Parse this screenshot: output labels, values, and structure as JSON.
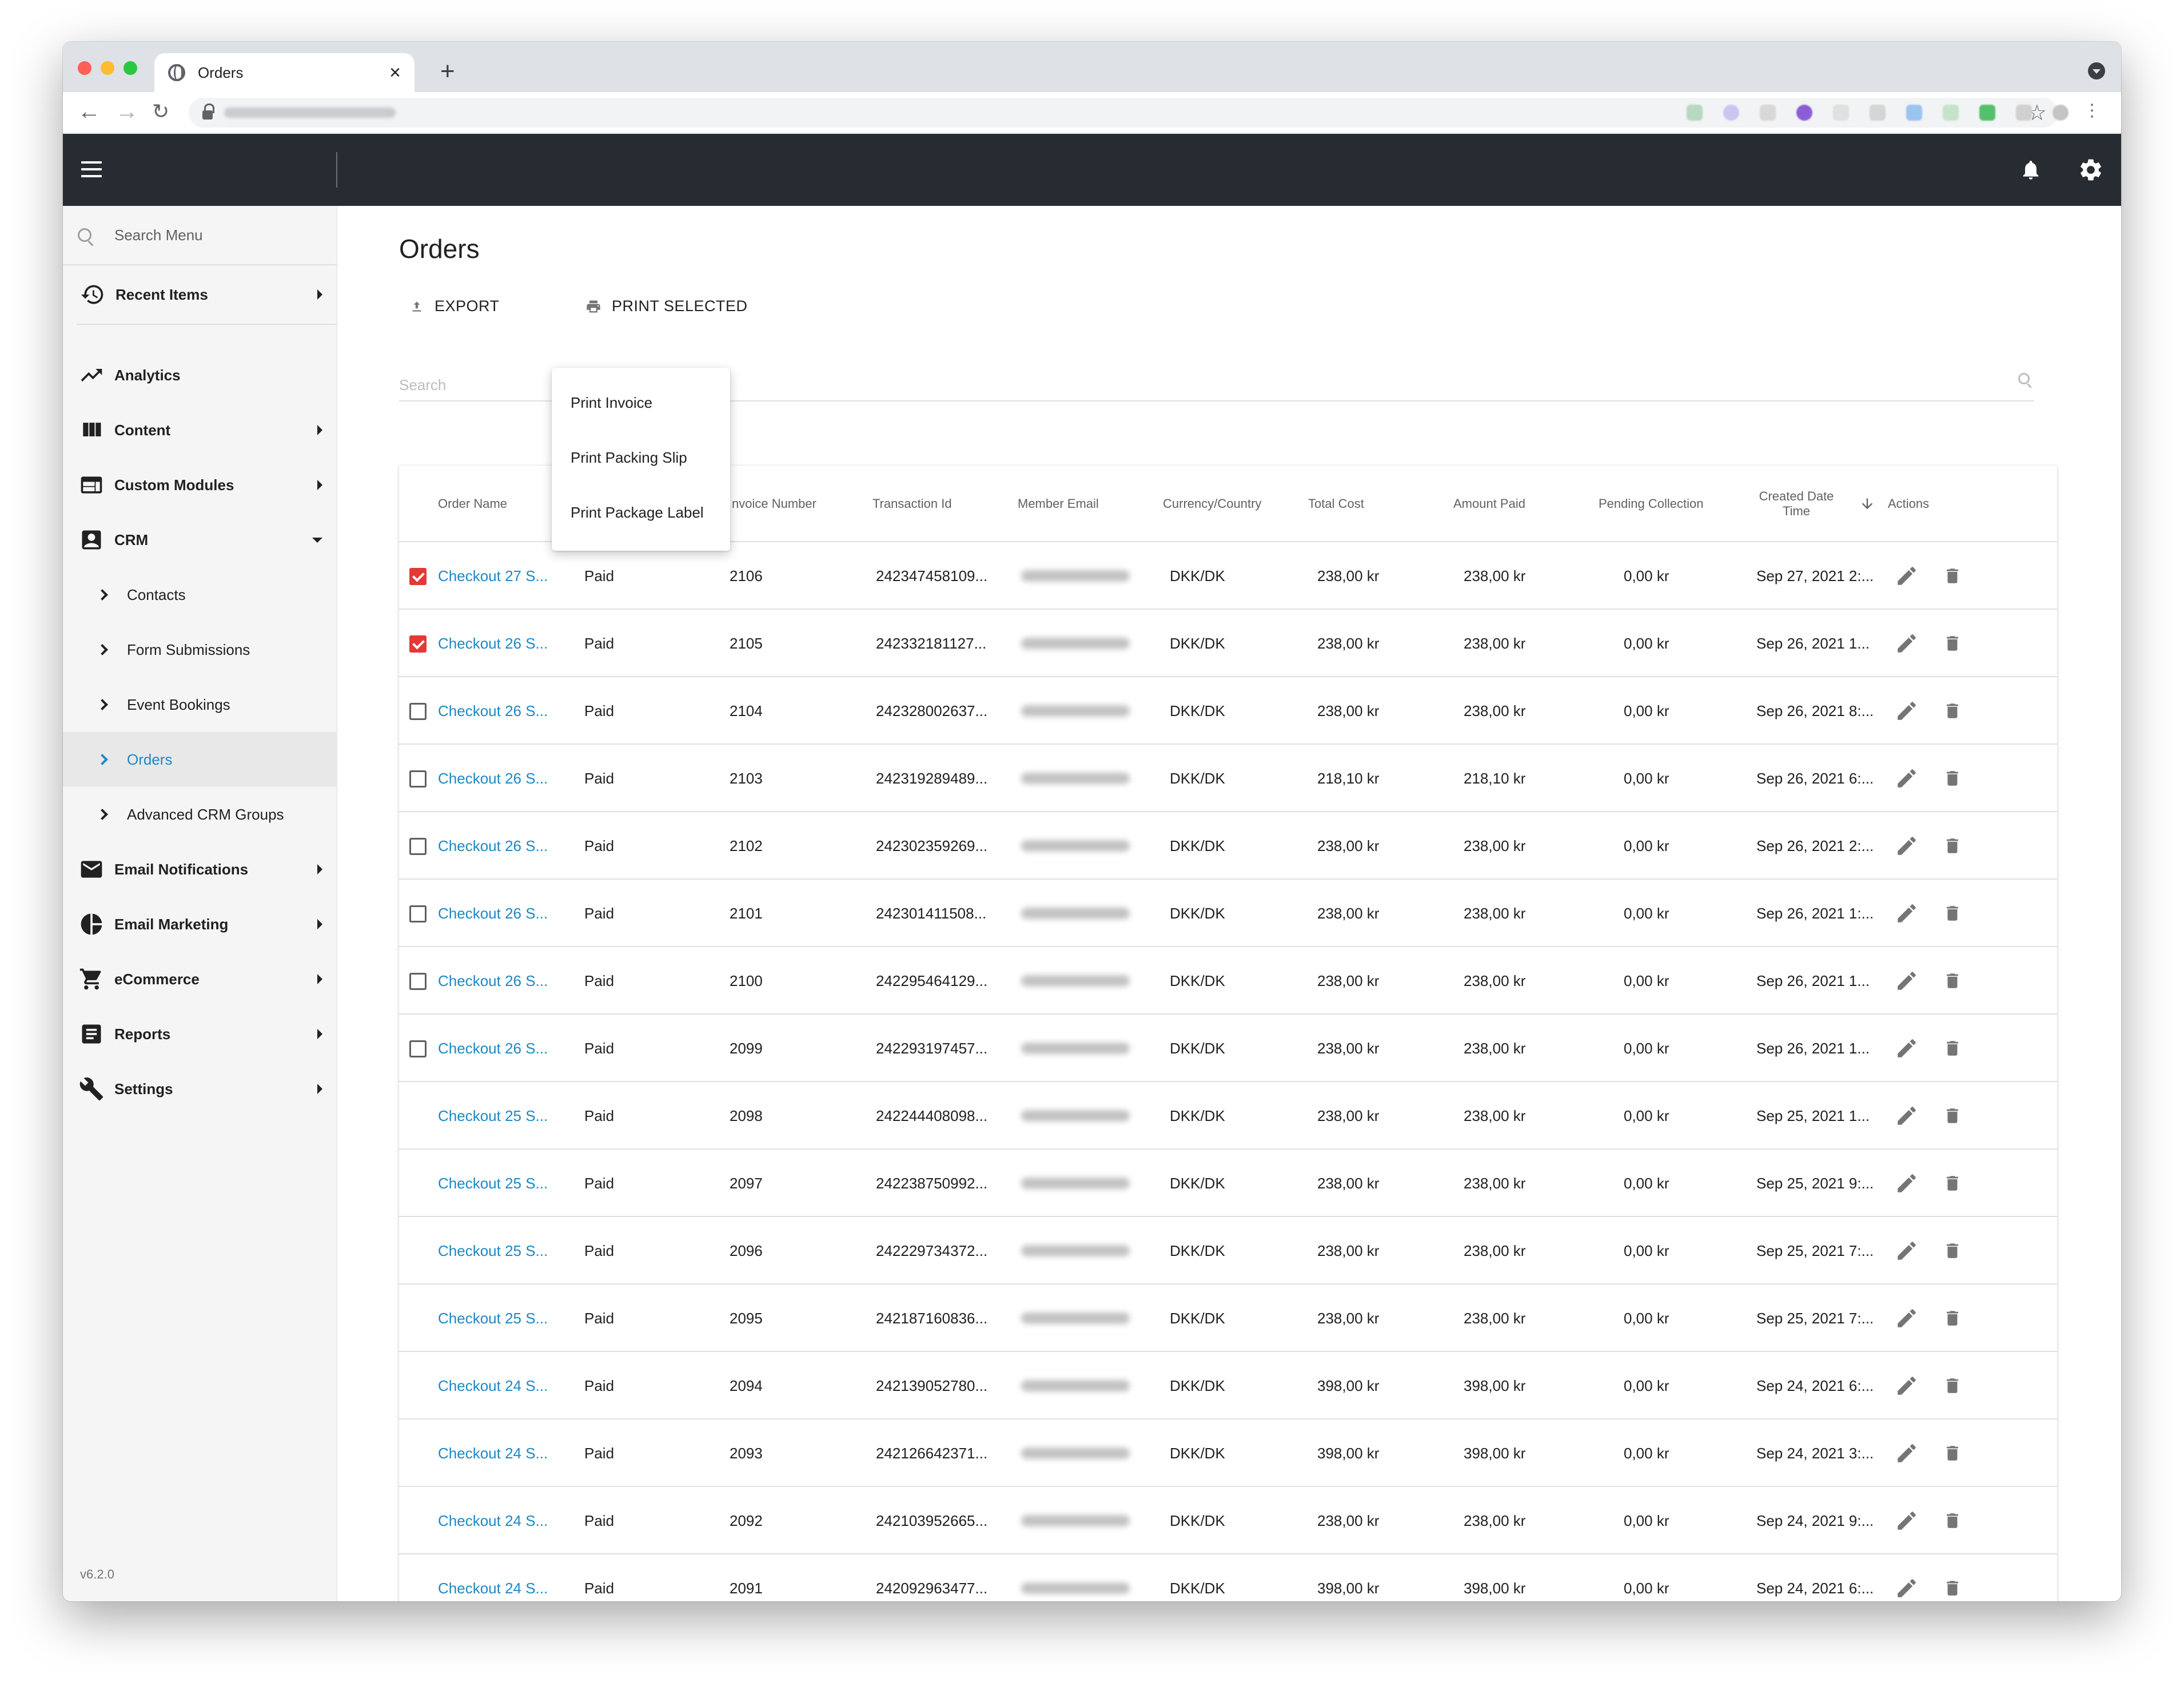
{
  "browser": {
    "tab_title": "Orders",
    "new_tab": "+"
  },
  "sidebar": {
    "search_placeholder": "Search Menu",
    "recent_items": "Recent Items",
    "items": [
      {
        "label": "Analytics",
        "icon": "trending-up-icon"
      },
      {
        "label": "Content",
        "icon": "view-columns-icon"
      },
      {
        "label": "Custom Modules",
        "icon": "web-module-icon"
      },
      {
        "label": "CRM",
        "icon": "contact-card-icon"
      },
      {
        "label": "Email Notifications",
        "icon": "mail-icon"
      },
      {
        "label": "Email Marketing",
        "icon": "pie-chart-icon"
      },
      {
        "label": "eCommerce",
        "icon": "shopping-cart-icon"
      },
      {
        "label": "Reports",
        "icon": "report-icon"
      },
      {
        "label": "Settings",
        "icon": "wrench-icon"
      }
    ],
    "crm_sub": [
      "Contacts",
      "Form Submissions",
      "Event Bookings",
      "Orders",
      "Advanced CRM Groups"
    ],
    "version": "v6.2.0"
  },
  "page": {
    "title": "Orders",
    "export_label": "EXPORT",
    "print_selected_label": "PRINT SELECTED",
    "search_placeholder": "Search"
  },
  "print_menu": [
    "Print Invoice",
    "Print Packing Slip",
    "Print Package Label"
  ],
  "table": {
    "headers": {
      "order_name": "Order Name",
      "invoice_number": "nvoice Number",
      "transaction_id": "Transaction Id",
      "member_email": "Member Email",
      "currency": "Currency/Country",
      "total_cost": "Total Cost",
      "amount_paid": "Amount Paid",
      "pending": "Pending Collection",
      "created": "Created Date Time",
      "actions": "Actions"
    },
    "rows": [
      {
        "name": "Checkout 27 S...",
        "status": "Paid",
        "invoice": "2106",
        "txn": "242347458109...",
        "currency": "DKK/DK",
        "total": "238,00 kr",
        "paid": "238,00 kr",
        "pending": "0,00 kr",
        "date": "Sep 27, 2021 2:..."
      },
      {
        "name": "Checkout 26 S...",
        "status": "Paid",
        "invoice": "2105",
        "txn": "242332181127...",
        "currency": "DKK/DK",
        "total": "238,00 kr",
        "paid": "238,00 kr",
        "pending": "0,00 kr",
        "date": "Sep 26, 2021 1..."
      },
      {
        "name": "Checkout 26 S...",
        "status": "Paid",
        "invoice": "2104",
        "txn": "242328002637...",
        "currency": "DKK/DK",
        "total": "238,00 kr",
        "paid": "238,00 kr",
        "pending": "0,00 kr",
        "date": "Sep 26, 2021 8:..."
      },
      {
        "name": "Checkout 26 S...",
        "status": "Paid",
        "invoice": "2103",
        "txn": "242319289489...",
        "currency": "DKK/DK",
        "total": "218,10 kr",
        "paid": "218,10 kr",
        "pending": "0,00 kr",
        "date": "Sep 26, 2021 6:..."
      },
      {
        "name": "Checkout 26 S...",
        "status": "Paid",
        "invoice": "2102",
        "txn": "242302359269...",
        "currency": "DKK/DK",
        "total": "238,00 kr",
        "paid": "238,00 kr",
        "pending": "0,00 kr",
        "date": "Sep 26, 2021 2:..."
      },
      {
        "name": "Checkout 26 S...",
        "status": "Paid",
        "invoice": "2101",
        "txn": "242301411508...",
        "currency": "DKK/DK",
        "total": "238,00 kr",
        "paid": "238,00 kr",
        "pending": "0,00 kr",
        "date": "Sep 26, 2021 1:..."
      },
      {
        "name": "Checkout 26 S...",
        "status": "Paid",
        "invoice": "2100",
        "txn": "242295464129...",
        "currency": "DKK/DK",
        "total": "238,00 kr",
        "paid": "238,00 kr",
        "pending": "0,00 kr",
        "date": "Sep 26, 2021 1..."
      },
      {
        "name": "Checkout 26 S...",
        "status": "Paid",
        "invoice": "2099",
        "txn": "242293197457...",
        "currency": "DKK/DK",
        "total": "238,00 kr",
        "paid": "238,00 kr",
        "pending": "0,00 kr",
        "date": "Sep 26, 2021 1..."
      },
      {
        "name": "Checkout 25 S...",
        "status": "Paid",
        "invoice": "2098",
        "txn": "242244408098...",
        "currency": "DKK/DK",
        "total": "238,00 kr",
        "paid": "238,00 kr",
        "pending": "0,00 kr",
        "date": "Sep 25, 2021 1..."
      },
      {
        "name": "Checkout 25 S...",
        "status": "Paid",
        "invoice": "2097",
        "txn": "242238750992...",
        "currency": "DKK/DK",
        "total": "238,00 kr",
        "paid": "238,00 kr",
        "pending": "0,00 kr",
        "date": "Sep 25, 2021 9:..."
      },
      {
        "name": "Checkout 25 S...",
        "status": "Paid",
        "invoice": "2096",
        "txn": "242229734372...",
        "currency": "DKK/DK",
        "total": "238,00 kr",
        "paid": "238,00 kr",
        "pending": "0,00 kr",
        "date": "Sep 25, 2021 7:..."
      },
      {
        "name": "Checkout 25 S...",
        "status": "Paid",
        "invoice": "2095",
        "txn": "242187160836...",
        "currency": "DKK/DK",
        "total": "238,00 kr",
        "paid": "238,00 kr",
        "pending": "0,00 kr",
        "date": "Sep 25, 2021 7:..."
      },
      {
        "name": "Checkout 24 S...",
        "status": "Paid",
        "invoice": "2094",
        "txn": "242139052780...",
        "currency": "DKK/DK",
        "total": "398,00 kr",
        "paid": "398,00 kr",
        "pending": "0,00 kr",
        "date": "Sep 24, 2021 6:..."
      },
      {
        "name": "Checkout 24 S...",
        "status": "Paid",
        "invoice": "2093",
        "txn": "242126642371...",
        "currency": "DKK/DK",
        "total": "398,00 kr",
        "paid": "398,00 kr",
        "pending": "0,00 kr",
        "date": "Sep 24, 2021 3:..."
      },
      {
        "name": "Checkout 24 S...",
        "status": "Paid",
        "invoice": "2092",
        "txn": "242103952665...",
        "currency": "DKK/DK",
        "total": "238,00 kr",
        "paid": "238,00 kr",
        "pending": "0,00 kr",
        "date": "Sep 24, 2021 9:..."
      },
      {
        "name": "Checkout 24 S...",
        "status": "Paid",
        "invoice": "2091",
        "txn": "242092963477...",
        "currency": "DKK/DK",
        "total": "398,00 kr",
        "paid": "398,00 kr",
        "pending": "0,00 kr",
        "date": "Sep 24, 2021 6:..."
      }
    ],
    "checked_rows": [
      true,
      true,
      false,
      false,
      false,
      false,
      false,
      false
    ],
    "checkbox_rows": 8
  },
  "colors": {
    "accent": "#1e88c7",
    "checkbox_checked": "#e53935",
    "appbar": "#272c33",
    "sidebar_bg": "#f5f5f5"
  }
}
